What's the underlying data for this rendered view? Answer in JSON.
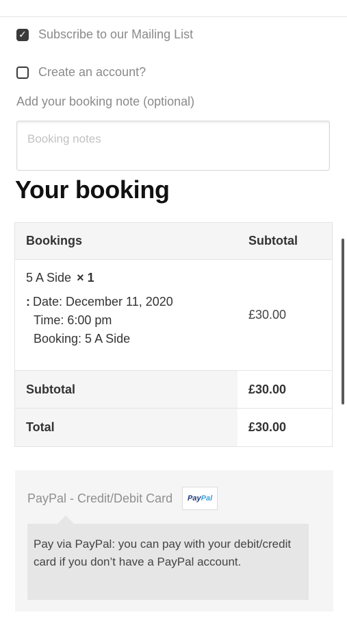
{
  "checkout": {
    "subscribe_label": "Subscribe to our Mailing List",
    "subscribe_checked": true,
    "create_account_label": "Create an account?",
    "create_account_checked": false,
    "note_label": "Add your booking note (optional)",
    "note_placeholder": "Booking notes",
    "note_value": ""
  },
  "booking": {
    "title": "Your booking",
    "header": {
      "left": "Bookings",
      "right": "Subtotal"
    },
    "item": {
      "name": "5 A Side",
      "qty": "× 1",
      "colon": ":",
      "date": "Date: December 11, 2020",
      "time": "Time: 6:00 pm",
      "booking": "Booking: 5 A Side",
      "price": "£30.00"
    },
    "subtotal": {
      "label": "Subtotal",
      "value": "£30.00"
    },
    "total": {
      "label": "Total",
      "value": "£30.00"
    }
  },
  "payment": {
    "method_label": "PayPal - Credit/Debit Card",
    "logo_text_dark": "Pay",
    "logo_text_light": "Pal",
    "description": "Pay via PayPal: you can pay with your debit/credit card if you don’t have a PayPal account."
  },
  "colors": {
    "text_muted": "#8a8a8a",
    "table_header_bg": "#f5f5f5",
    "payment_bg": "#f5f5f5",
    "description_bg": "#e6e6e6",
    "paypal_dark": "#1f3a7a",
    "paypal_light": "#3aa0dc"
  },
  "icons": {
    "subscribe_checkbox": "checkbox-checked-icon",
    "account_checkbox": "checkbox-unchecked-icon",
    "paypal_logo": "paypal-logo-icon"
  }
}
